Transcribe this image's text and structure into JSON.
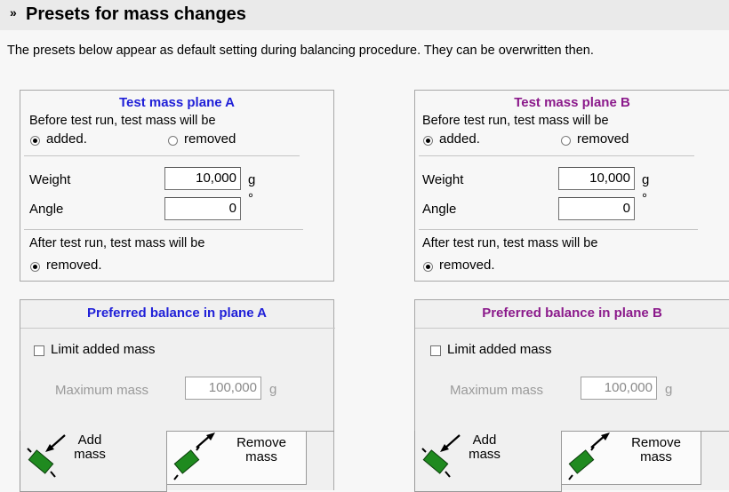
{
  "header": {
    "chevron": "»",
    "title": "Presets for mass changes"
  },
  "description": "The presets below appear as default setting during balancing procedure. They can be overwritten then.",
  "test_mass": [
    {
      "title": "Test mass plane A",
      "before_label": "Before test run, test mass will be",
      "added_label": "added.",
      "removed_label": "removed",
      "weight_label": "Weight",
      "weight_value": "10,000",
      "weight_unit": "g",
      "angle_label": "Angle",
      "angle_value": "0",
      "angle_unit": "°",
      "after_label": "After test run, test mass will be",
      "after_option": "removed."
    },
    {
      "title": "Test mass plane B",
      "before_label": "Before test run, test mass will be",
      "added_label": "added.",
      "removed_label": "removed",
      "weight_label": "Weight",
      "weight_value": "10,000",
      "weight_unit": "g",
      "angle_label": "Angle",
      "angle_value": "0",
      "angle_unit": "°",
      "after_label": "After test run, test mass will be",
      "after_option": "removed."
    }
  ],
  "preferred": [
    {
      "title": "Preferred balance in plane A",
      "limit_label": "Limit added mass",
      "limit_checked": false,
      "max_label": "Maximum mass",
      "max_value": "100,000",
      "max_unit": "g",
      "add_tab": {
        "line1": "Add",
        "line2": "mass"
      },
      "remove_tab": {
        "line1": "Remove",
        "line2": "mass"
      }
    },
    {
      "title": "Preferred balance in plane B",
      "limit_label": "Limit added mass",
      "limit_checked": false,
      "max_label": "Maximum mass",
      "max_value": "100,000",
      "max_unit": "g",
      "add_tab": {
        "line1": "Add",
        "line2": "mass"
      },
      "remove_tab": {
        "line1": "Remove",
        "line2": "mass"
      }
    }
  ],
  "colors": {
    "plane_a_title": "#2020d8",
    "plane_b_title": "#8b1a8b",
    "mass_icon": "#1f8a1f"
  }
}
